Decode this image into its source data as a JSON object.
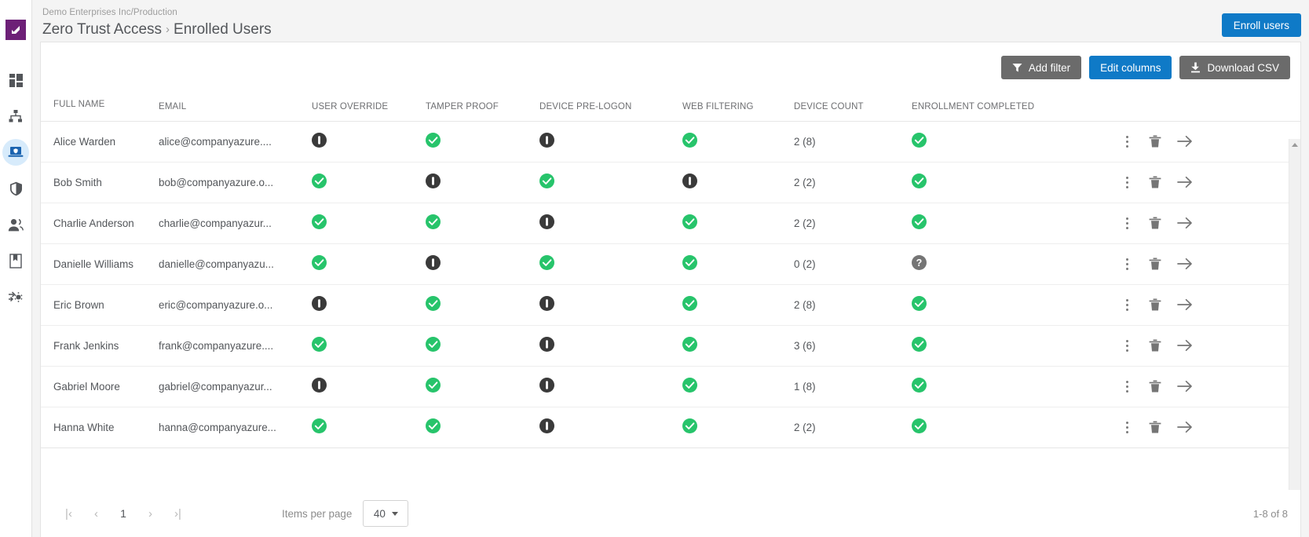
{
  "sidebar": {
    "logo_name": "logo-mark",
    "items": [
      {
        "icon": "dashboard-grid-icon",
        "name": "sidebar-item-dashboard",
        "active": false
      },
      {
        "icon": "org-hierarchy-icon",
        "name": "sidebar-item-network",
        "active": false
      },
      {
        "icon": "laptop-secure-icon",
        "name": "sidebar-item-zero-trust-access",
        "active": true
      },
      {
        "icon": "shield-icon",
        "name": "sidebar-item-security",
        "active": false
      },
      {
        "icon": "users-icon",
        "name": "sidebar-item-users",
        "active": false
      },
      {
        "icon": "book-icon",
        "name": "sidebar-item-library",
        "active": false
      },
      {
        "icon": "gear-settings-icon",
        "name": "sidebar-item-settings",
        "active": false
      }
    ]
  },
  "header": {
    "breadcrumb_top": "Demo Enterprises Inc/Production",
    "section": "Zero Trust Access",
    "separator": "›",
    "page": "Enrolled Users",
    "enroll_button": "Enroll users"
  },
  "toolbar": {
    "add_filter": "Add filter",
    "edit_columns": "Edit columns",
    "download_csv": "Download CSV"
  },
  "table": {
    "columns": [
      "FULL NAME",
      "EMAIL",
      "USER OVERRIDE",
      "TAMPER PROOF",
      "DEVICE PRE-LOGON",
      "WEB FILTERING",
      "DEVICE COUNT",
      "ENROLLMENT COMPLETED"
    ],
    "rows": [
      {
        "name": "Alice Warden",
        "email": "alice@companyazure....",
        "user_override": "off",
        "tamper_proof": "on",
        "device_pre_logon": "off",
        "web_filtering": "on",
        "device_count": "2 (8)",
        "enrollment_completed": "on"
      },
      {
        "name": "Bob Smith",
        "email": "bob@companyazure.o...",
        "user_override": "on",
        "tamper_proof": "off",
        "device_pre_logon": "on",
        "web_filtering": "off",
        "device_count": "2 (2)",
        "enrollment_completed": "on"
      },
      {
        "name": "Charlie Anderson",
        "email": "charlie@companyazur...",
        "user_override": "on",
        "tamper_proof": "on",
        "device_pre_logon": "off",
        "web_filtering": "on",
        "device_count": "2 (2)",
        "enrollment_completed": "on"
      },
      {
        "name": "Danielle Williams",
        "email": "danielle@companyazu...",
        "user_override": "on",
        "tamper_proof": "off",
        "device_pre_logon": "on",
        "web_filtering": "on",
        "device_count": "0 (2)",
        "enrollment_completed": "unknown"
      },
      {
        "name": "Eric Brown",
        "email": "eric@companyazure.o...",
        "user_override": "off",
        "tamper_proof": "on",
        "device_pre_logon": "off",
        "web_filtering": "on",
        "device_count": "2 (8)",
        "enrollment_completed": "on"
      },
      {
        "name": "Frank Jenkins",
        "email": "frank@companyazure....",
        "user_override": "on",
        "tamper_proof": "on",
        "device_pre_logon": "off",
        "web_filtering": "on",
        "device_count": "3 (6)",
        "enrollment_completed": "on"
      },
      {
        "name": "Gabriel Moore",
        "email": "gabriel@companyazur...",
        "user_override": "off",
        "tamper_proof": "on",
        "device_pre_logon": "off",
        "web_filtering": "on",
        "device_count": "1 (8)",
        "enrollment_completed": "on"
      },
      {
        "name": "Hanna White",
        "email": "hanna@companyazure...",
        "user_override": "on",
        "tamper_proof": "on",
        "device_pre_logon": "off",
        "web_filtering": "on",
        "device_count": "2 (2)",
        "enrollment_completed": "on"
      }
    ],
    "row_actions": [
      "more-options-icon",
      "delete-icon",
      "open-details-icon"
    ]
  },
  "footer": {
    "first_page": "|‹",
    "prev_page": "‹",
    "current_page": "1",
    "next_page": "›",
    "last_page": "›|",
    "items_per_page_label": "Items per page",
    "items_per_page_value": "40",
    "range": "1-8 of 8"
  },
  "colors": {
    "accent_blue": "#0f7ac7",
    "brand_purple": "#6d2077",
    "status_on_green": "#27c46b",
    "status_off_dark": "#3a3a3a",
    "status_unknown_grey": "#757575",
    "toolbar_grey": "#6b6b6b"
  }
}
